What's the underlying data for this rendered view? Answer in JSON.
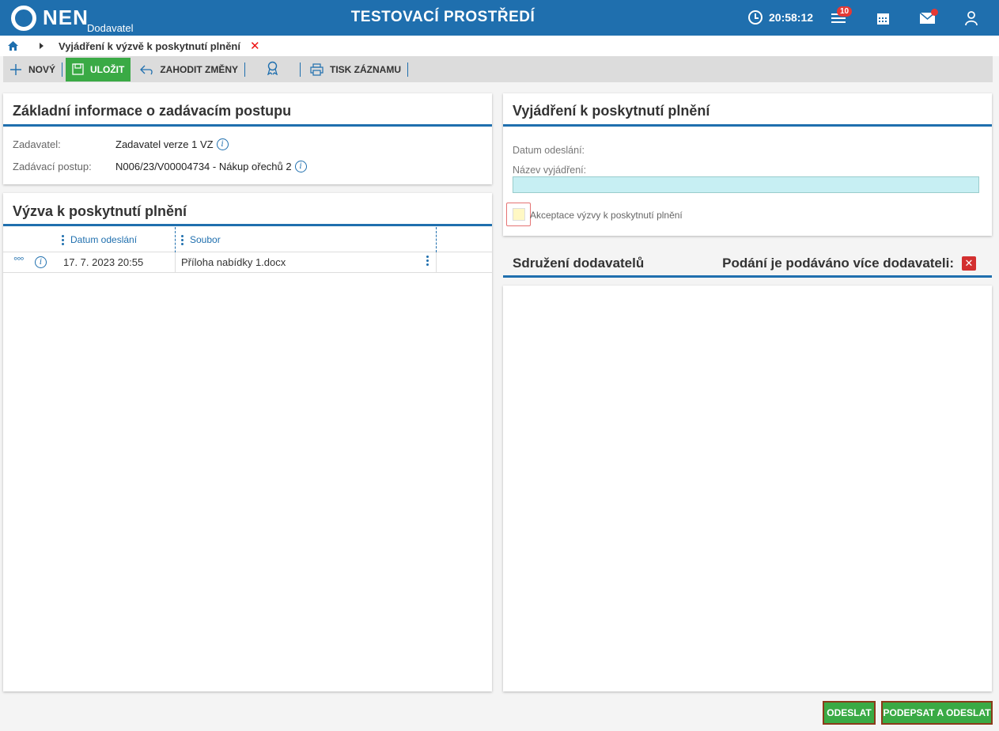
{
  "header": {
    "logo_text": "NEN",
    "logo_sub": "Dodavatel",
    "environment": "TESTOVACÍ PROSTŘEDÍ",
    "time": "20:58:12",
    "notifications_count": "10",
    "icons": [
      "clock-icon",
      "menu-icon",
      "calendar-icon",
      "mail-icon",
      "user-icon"
    ],
    "brand_color": "#1f6fae"
  },
  "breadcrumb": {
    "title": "Vyjádření k výzvě k poskytnutí plnění",
    "close": "✕"
  },
  "toolbar": {
    "new_label": "NOVÝ",
    "save_label": "ULOŽIT",
    "discard_label": "ZAHODIT ZMĚNY",
    "print_label": "TISK ZÁZNAMU"
  },
  "basic_info": {
    "title": "Základní informace o zadávacím postupu",
    "contracting_label": "Zadavatel:",
    "contracting_value": "Zadavatel verze 1 VZ",
    "procedure_label": "Zadávací postup:",
    "procedure_value": "N006/23/V00004734 - Nákup ořechů 2"
  },
  "challenge": {
    "title": "Výzva k poskytnutí plnění",
    "columns": [
      "Datum odeslání",
      "Soubor"
    ],
    "rows": [
      {
        "date": "17. 7. 2023 20:55",
        "file": "Příloha nabídky 1.docx",
        "actions": "°°°"
      }
    ]
  },
  "statement": {
    "title": "Vyjádření k poskytnutí plnění",
    "sent_date_label": "Datum odeslání:",
    "name_label": "Název vyjádření:",
    "name_value": "",
    "acceptance_label": "Akceptace výzvy k poskytnutí plnění"
  },
  "association": {
    "title": "Sdružení dodavatelů",
    "multi_label": "Podání je podáváno více dodavateli:",
    "multi_value": "✕"
  },
  "footer": {
    "send_label": "ODESLAT",
    "sign_send_label": "PODEPSAT A ODESLAT",
    "accent_color": "#3aaa45"
  }
}
